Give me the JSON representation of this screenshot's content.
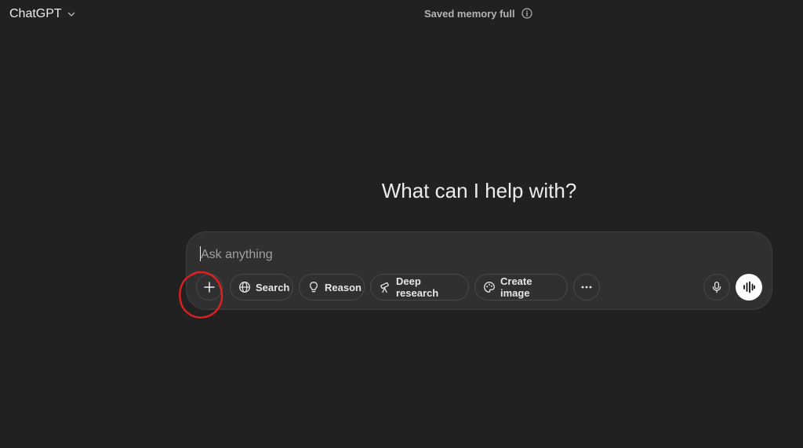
{
  "header": {
    "model_name": "ChatGPT",
    "memory_status": "Saved memory full"
  },
  "main": {
    "heading": "What can I help with?"
  },
  "composer": {
    "placeholder": "Ask anything",
    "tools": [
      {
        "label": "Search",
        "icon": "globe-icon"
      },
      {
        "label": "Reason",
        "icon": "lightbulb-icon"
      },
      {
        "label": "Deep research",
        "icon": "telescope-icon"
      },
      {
        "label": "Create image",
        "icon": "palette-icon"
      }
    ]
  },
  "annotation": {
    "color": "#e02020",
    "target": "add-attachment-button"
  },
  "colors": {
    "background": "#212121",
    "composer": "#303030",
    "text": "#ececec"
  }
}
